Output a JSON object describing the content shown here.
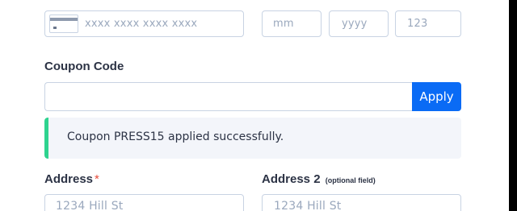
{
  "payment": {
    "card_number_placeholder": "xxxx xxxx xxxx xxxx",
    "month_placeholder": "mm",
    "year_placeholder": "yyyy",
    "cvc_placeholder": "123"
  },
  "coupon": {
    "label": "Coupon Code",
    "value": "",
    "apply_label": "Apply",
    "success_message": "Coupon PRESS15 applied successfully."
  },
  "address": {
    "label": "Address",
    "required_mark": "*",
    "placeholder": "1234 Hill St"
  },
  "address2": {
    "label": "Address 2",
    "optional_note": "(optional field)",
    "placeholder": "1234 Hill St"
  },
  "colors": {
    "primary": "#0a6bf5",
    "success": "#2ed38f",
    "required": "#e74c3c",
    "border": "#c8d3e3"
  },
  "icons": {
    "card": "credit-card-icon"
  }
}
